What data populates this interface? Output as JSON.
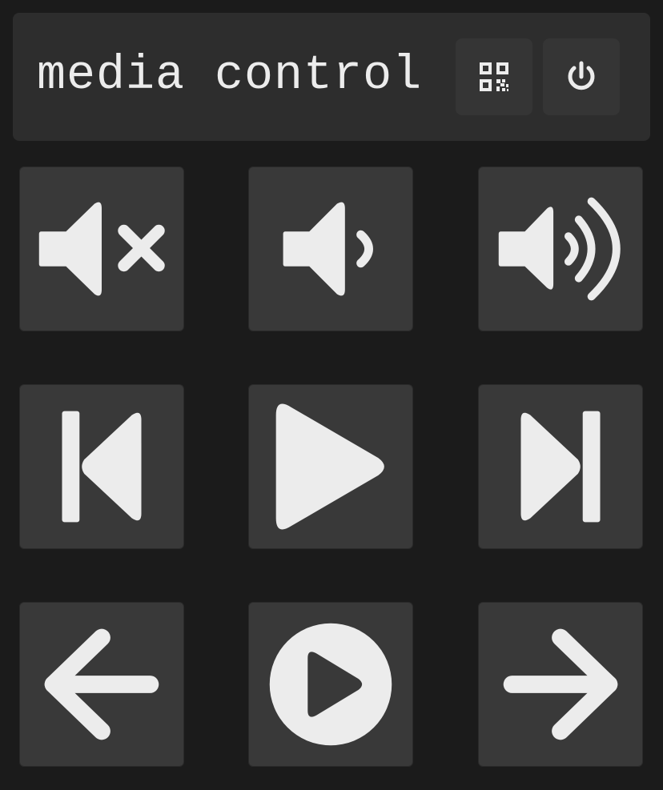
{
  "header": {
    "title": "media control",
    "buttons": [
      {
        "icon": "qr-code-icon"
      },
      {
        "icon": "power-icon"
      }
    ]
  },
  "colors": {
    "background": "#1b1b1b",
    "panel": "#2d2d2d",
    "tile": "#393939",
    "icon": "#ececec"
  },
  "grid": [
    [
      "volume-mute-icon",
      "volume-low-icon",
      "volume-high-icon"
    ],
    [
      "skip-previous-icon",
      "play-icon",
      "skip-next-icon"
    ],
    [
      "arrow-left-icon",
      "play-circle-icon",
      "arrow-right-icon"
    ]
  ]
}
